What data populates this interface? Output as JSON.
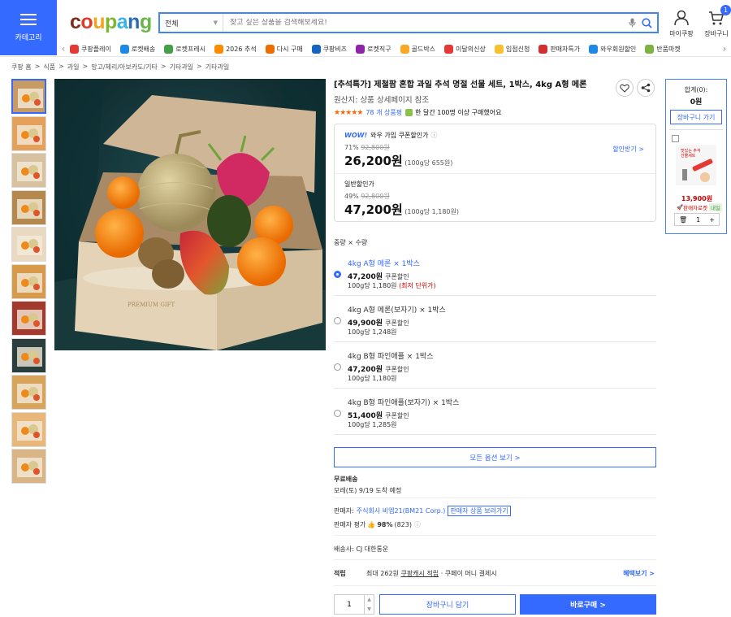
{
  "header": {
    "category_label": "카테고리",
    "logo": {
      "c": "c",
      "o": "o",
      "u": "u",
      "p": "p",
      "a": "a",
      "n": "n",
      "g": "g"
    },
    "search_scope": "전체",
    "search_placeholder": "찾고 싶은 상품을 검색해보세요!",
    "my_coupang": "마이쿠팡",
    "cart": "장바구니",
    "cart_badge": "1"
  },
  "quick_links": [
    {
      "label": "쿠팡플레이",
      "color": "#e53935"
    },
    {
      "label": "로켓배송",
      "color": "#1e88e5"
    },
    {
      "label": "로켓프레시",
      "color": "#43a047"
    },
    {
      "label": "2026 추석",
      "color": "#fb8c00"
    },
    {
      "label": "다시 구매",
      "color": "#ef6c00"
    },
    {
      "label": "쿠팡비즈",
      "color": "#1565c0"
    },
    {
      "label": "로켓직구",
      "color": "#8e24aa"
    },
    {
      "label": "골드박스",
      "color": "#f9a825"
    },
    {
      "label": "이달의신상",
      "color": "#e53935"
    },
    {
      "label": "입점신청",
      "color": "#fbc02d"
    },
    {
      "label": "판매자특가",
      "color": "#d32f2f"
    },
    {
      "label": "와우회원할인",
      "color": "#1e88e5"
    },
    {
      "label": "반품마켓",
      "color": "#7cb342"
    }
  ],
  "breadcrumb": [
    "쿠팡 홈",
    ">",
    "식품",
    ">",
    "과일",
    ">",
    "망고/체리/아보카도/기타",
    ">",
    "기타과일",
    ">",
    "기타과일"
  ],
  "product": {
    "title": "[추석특가] 제철팜 혼합 과일 추석 명절 선물 세트, 1박스, 4kg A형 메론",
    "origin": "원산지: 상품 상세페이지 참조",
    "stars": "★★★★★",
    "review_count": "78 개 상품평",
    "monthly": "한 달간 100명 이상 구매했어요",
    "box_text": "PREMIUM GIFT"
  },
  "price": {
    "wow_label": "와우 가입 쿠폰할인가",
    "wow_logo": "WOW!",
    "wow_discount": "71%",
    "wow_original": "92,800원",
    "wow_price": "26,200원",
    "wow_unit": "(100g당 655원)",
    "coupon_link": "할인받기 >",
    "normal_label": "일반할인가",
    "normal_discount": "49%",
    "normal_original": "92,800원",
    "normal_price": "47,200원",
    "normal_unit": "(100g당 1,180원)"
  },
  "options": {
    "label": "중량 × 수량",
    "items": [
      {
        "name": "4kg A형 메론 × 1박스",
        "price": "47,200원",
        "tag": "쿠폰할인",
        "unit": "100g당 1,180원",
        "note": "(최저 단위가)"
      },
      {
        "name": "4kg A형 메론(보자기) × 1박스",
        "price": "49,900원",
        "tag": "쿠폰할인",
        "unit": "100g당 1,248원",
        "note": ""
      },
      {
        "name": "4kg B형 파인애플 × 1박스",
        "price": "47,200원",
        "tag": "쿠폰할인",
        "unit": "100g당 1,180원",
        "note": ""
      },
      {
        "name": "4kg B형 파인애플(보자기) × 1박스",
        "price": "51,400원",
        "tag": "쿠폰할인",
        "unit": "100g당 1,285원",
        "note": ""
      }
    ],
    "all_button": "모든 옵션 보기 >"
  },
  "shipping": {
    "title": "무료배송",
    "date": "모레(토) 9/19 도착 예정"
  },
  "seller": {
    "prefix": "판매자:",
    "name": "주식회사 비엠21(BM21 Corp.)",
    "more": "판매자 상품 보러가기",
    "rating_label": "판매자 평가",
    "rating": "98%",
    "rating_count": "(823)"
  },
  "carrier": "배송사: CJ 대한통운",
  "reward": {
    "label": "적립",
    "text1": "최대 262원",
    "text2": "쿠팡캐시 적립",
    "text3": "· 쿠페이 머니 결제시",
    "link": "혜택보기 >"
  },
  "buy": {
    "qty": "1",
    "cart": "장바구니 담기",
    "buy_now": "바로구매 >"
  },
  "side_cart": {
    "total_label": "합계(0):",
    "total": "0원",
    "go": "장바구니 가기",
    "item_price": "13,900원",
    "rocket": "판매자로켓",
    "rocket_tag": "내일",
    "qty": "1",
    "img_text1": "맛있는 추석",
    "img_text2": "선물세트"
  }
}
